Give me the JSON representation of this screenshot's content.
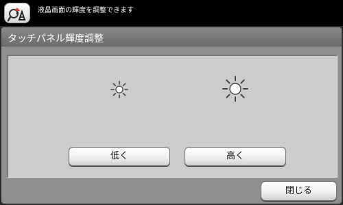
{
  "header": {
    "help_icon": "help-guide-icon",
    "message": "液晶画面の輝度を調整できます"
  },
  "panel": {
    "title": "タッチパネル輝度調整"
  },
  "brightness": {
    "decrease_icon": "sun-small-icon",
    "increase_icon": "sun-large-icon",
    "decrease_label": "低く",
    "increase_label": "高く"
  },
  "footer": {
    "close_label": "閉じる"
  },
  "colors": {
    "topbar": "#000000",
    "panel": "#8f8f8f",
    "content": "#cccccc",
    "button_face": "#f0f0f0"
  }
}
